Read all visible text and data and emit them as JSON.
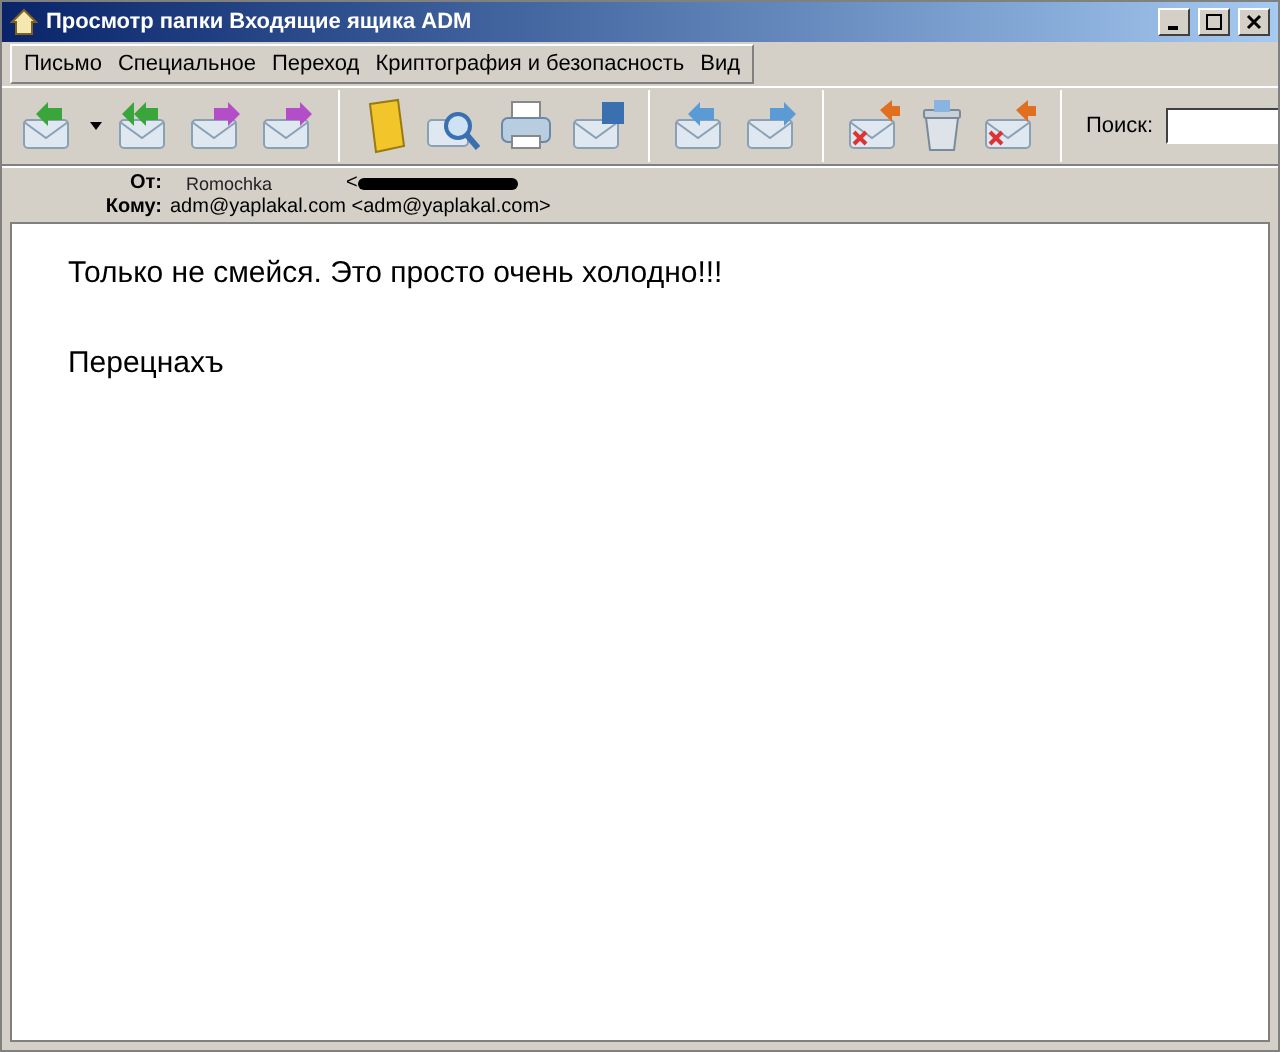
{
  "window": {
    "title": "Просмотр папки Входящие ящика ADM"
  },
  "menu": [
    "Письмо",
    "Специальное",
    "Переход",
    "Криптография и безопасность",
    "Вид"
  ],
  "search": {
    "label": "Поиск:"
  },
  "header": {
    "from_label": "От:",
    "from_name": "Romochka",
    "from_address": "<",
    "to_label": "Кому:",
    "to_value": "adm@yaplakal.com <adm@yaplakal.com>"
  },
  "body": [
    "Только не смейся. Это просто очень холодно!!!",
    "Перецнахъ"
  ]
}
